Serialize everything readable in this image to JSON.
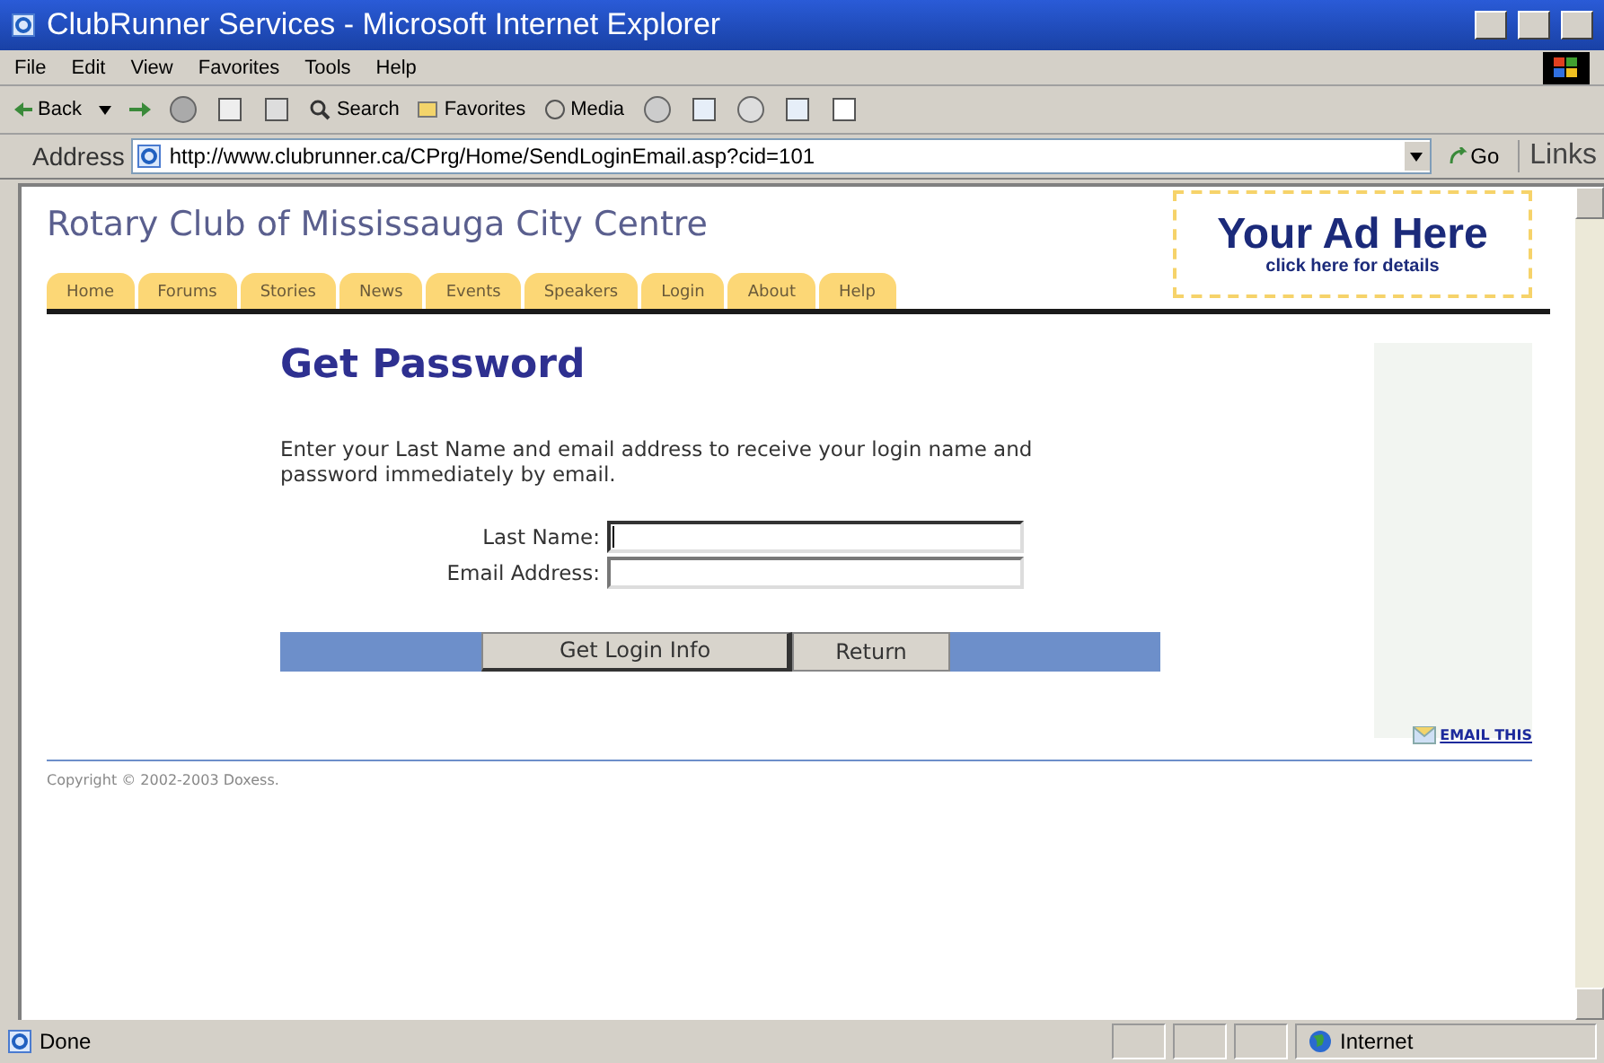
{
  "window": {
    "title": "ClubRunner Services - Microsoft Internet Explorer"
  },
  "menu": [
    "File",
    "Edit",
    "View",
    "Favorites",
    "Tools",
    "Help"
  ],
  "toolbar": {
    "back": "Back",
    "search": "Search",
    "favorites": "Favorites",
    "media": "Media"
  },
  "address": {
    "label": "Address",
    "url": "http://www.clubrunner.ca/CPrg/Home/SendLoginEmail.asp?cid=101",
    "go": "Go",
    "links": "Links"
  },
  "site": {
    "title": "Rotary Club of Mississauga City Centre",
    "tabs": [
      "Home",
      "Forums",
      "Stories",
      "News",
      "Events",
      "Speakers",
      "Login",
      "About",
      "Help"
    ],
    "ad": {
      "headline": "Your Ad Here",
      "subline": "click here for details"
    }
  },
  "form": {
    "heading": "Get Password",
    "intro": "Enter your Last Name and email address to receive your login name and password immediately by email.",
    "fields": [
      {
        "label": "Last Name:",
        "focused": true
      },
      {
        "label": "Email Address:",
        "focused": false
      }
    ],
    "buttons": [
      "Get Login Info",
      "Return"
    ]
  },
  "email_this": "EMAIL THIS",
  "copyright": "Copyright © 2002-2003 Doxess.",
  "status_bar": {
    "text": "Done",
    "zone": "Internet"
  }
}
